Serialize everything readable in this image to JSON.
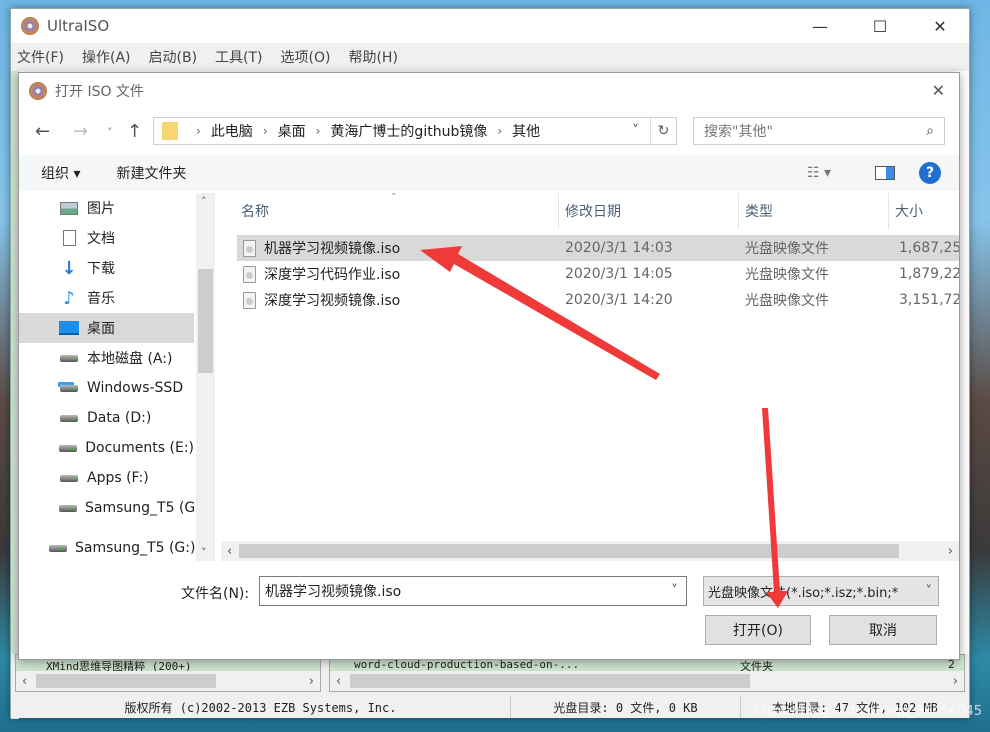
{
  "app": {
    "title": "UltraISO",
    "menu": [
      "文件(F)",
      "操作(A)",
      "启动(B)",
      "工具(T)",
      "选项(O)",
      "帮助(H)"
    ],
    "bottom_left_item": "XMind思维导图精粹 (200+)",
    "bottom_right_item": "word-cloud-production-based-on-...",
    "bottom_right_type": "文件夹",
    "bottom_right_size": "2",
    "status": {
      "copyright": "版权所有 (c)2002-2013 EZB Systems, Inc.",
      "disc_dir": "光盘目录: 0 文件, 0 KB",
      "local_dir": "本地目录: 47 文件, 102 MB"
    }
  },
  "dialog": {
    "title": "打开 ISO 文件",
    "breadcrumb": [
      "此电脑",
      "桌面",
      "黄海广博士的github镜像",
      "其他"
    ],
    "search_placeholder": "搜索\"其他\"",
    "toolbar": {
      "organize": "组织 ▾",
      "new_folder": "新建文件夹"
    },
    "nav": [
      {
        "label": "图片",
        "icon": "pictures-icon"
      },
      {
        "label": "文档",
        "icon": "documents-icon"
      },
      {
        "label": "下载",
        "icon": "download-icon"
      },
      {
        "label": "音乐",
        "icon": "music-icon"
      },
      {
        "label": "桌面",
        "icon": "desktop-icon",
        "selected": true
      },
      {
        "label": "本地磁盘 (A:)",
        "icon": "drive-icon"
      },
      {
        "label": "Windows-SSD",
        "icon": "windows-drive-icon"
      },
      {
        "label": "Data (D:)",
        "icon": "drive-icon"
      },
      {
        "label": "Documents (E:)",
        "icon": "drive-icon"
      },
      {
        "label": "Apps (F:)",
        "icon": "drive-icon"
      },
      {
        "label": "Samsung_T5 (G",
        "icon": "drive-icon"
      },
      {
        "label": "Samsung_T5 (G:)",
        "icon": "drive-icon"
      }
    ],
    "columns": [
      "名称",
      "修改日期",
      "类型",
      "大小"
    ],
    "files": [
      {
        "name": "机器学习视频镜像.iso",
        "date": "2020/3/1 14:03",
        "type": "光盘映像文件",
        "size": "1,687,25",
        "selected": true
      },
      {
        "name": "深度学习代码作业.iso",
        "date": "2020/3/1 14:05",
        "type": "光盘映像文件",
        "size": "1,879,22"
      },
      {
        "name": "深度学习视频镜像.iso",
        "date": "2020/3/1 14:20",
        "type": "光盘映像文件",
        "size": "3,151,72"
      }
    ],
    "filename_label": "文件名(N):",
    "filename_value": "机器学习视频镜像.iso",
    "filter": "光盘映像文件(*.iso;*.isz;*.bin;*",
    "open": "打开(O)",
    "cancel": "取消"
  },
  "watermark": "https://blog.csdn.net/qq_36456045",
  "colors": {
    "arrow": "#f03a3a",
    "help": "#1e6fd0",
    "selection": "#d9d9d9"
  }
}
